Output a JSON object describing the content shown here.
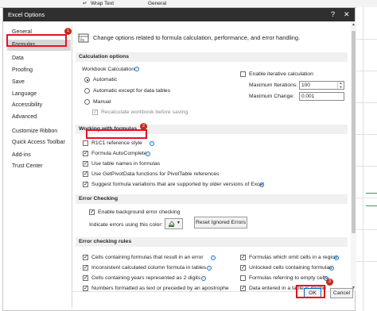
{
  "background": {
    "ribbon_text": [
      "",
      "Wrap Text",
      "General"
    ]
  },
  "dialog": {
    "title": "Excel Options",
    "help_glyph": "?",
    "close_glyph": "✕"
  },
  "sidebar": {
    "items": [
      {
        "label": "General"
      },
      {
        "label": "Formulas"
      },
      {
        "label": "Data"
      },
      {
        "label": "Proofing"
      },
      {
        "label": "Save"
      },
      {
        "label": "Language"
      },
      {
        "label": "Accessibility"
      },
      {
        "label": "Advanced"
      },
      {
        "label": "Customize Ribbon"
      },
      {
        "label": "Quick Access Toolbar"
      },
      {
        "label": "Add-ins"
      },
      {
        "label": "Trust Center"
      }
    ],
    "active_index": 1
  },
  "callouts": [
    "1",
    "2",
    "3"
  ],
  "header": {
    "text": "Change options related to formula calculation, performance, and error handling."
  },
  "calculation": {
    "section_title": "Calculation options",
    "workbook_calc_label": "Workbook Calculation",
    "automatic": "Automatic",
    "automatic_except": "Automatic except for data tables",
    "manual": "Manual",
    "recalc_before_save": "Recalculate workbook before saving",
    "enable_iterative": "Enable iterative calculation",
    "max_iterations_label": "Maximum Iterations:",
    "max_iterations_value": "100",
    "max_change_label": "Maximum Change:",
    "max_change_value": "0.001",
    "selected": "Automatic"
  },
  "working": {
    "section_title": "Working with formulas",
    "r1c1": {
      "label": "R1C1 reference style",
      "checked": false
    },
    "autocomplete": {
      "label": "Formula AutoComplete",
      "checked": true
    },
    "table_names": {
      "label": "Use table names in formulas",
      "checked": true
    },
    "getpivotdata": {
      "label": "Use GetPivotData functions for PivotTable references",
      "checked": true
    },
    "suggest": {
      "label": "Suggest formula variations that are supported by older versions of Excel",
      "checked": true
    }
  },
  "error_checking": {
    "section_title": "Error Checking",
    "enable_bg": {
      "label": "Enable background error checking",
      "checked": true
    },
    "indicate_color_label": "Indicate errors using this color:",
    "reset_button": "Reset Ignored Errors",
    "indicator_color": "#2e7d32"
  },
  "rules": {
    "section_title": "Error checking rules",
    "left": [
      {
        "label": "Cells containing formulas that result in an error",
        "checked": true
      },
      {
        "label": "Inconsistent calculated column formula in tables",
        "checked": true
      },
      {
        "label": "Cells containing years represented as 2 digits",
        "checked": true
      },
      {
        "label": "Numbers formatted as text or preceded by an apostrophe",
        "checked": true
      }
    ],
    "right": [
      {
        "label": "Formulas which omit cells in a region",
        "checked": true
      },
      {
        "label": "Unlocked cells containing formulas",
        "checked": true
      },
      {
        "label": "Formulas referring to empty cells",
        "checked": false
      },
      {
        "label": "Data entered in a table is invalid",
        "checked": true
      }
    ]
  },
  "footer": {
    "ok": "OK",
    "cancel": "Cancel"
  },
  "colors": {
    "highlight": "#e81123",
    "title_bar": "#2f2f2f",
    "active_sidebar": "#d7d7d7",
    "section_bg": "#f0f0f0"
  }
}
